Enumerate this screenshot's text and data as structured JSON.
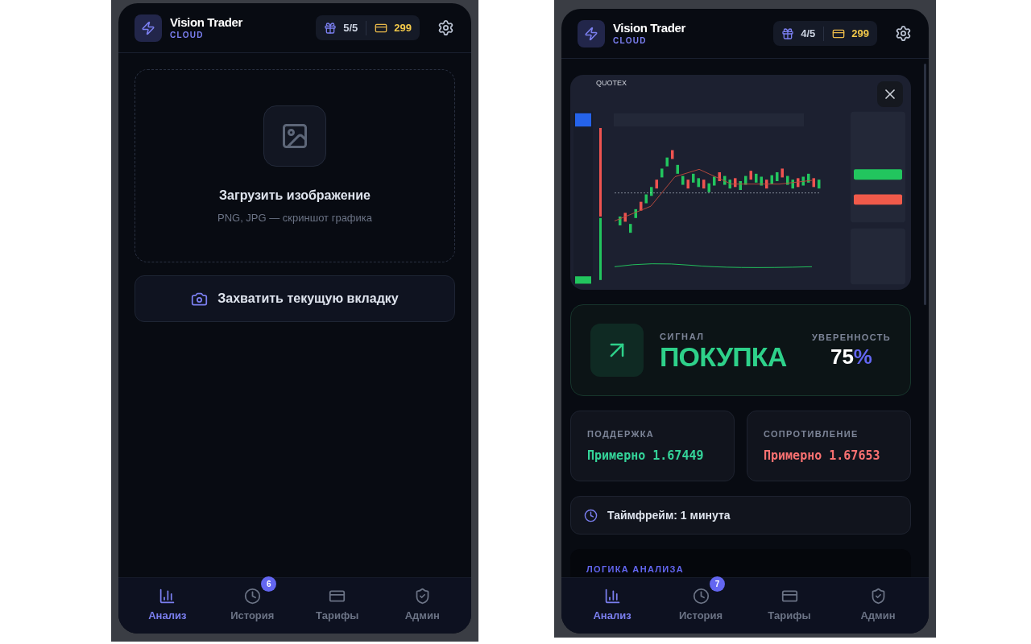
{
  "panels": [
    {
      "header": {
        "title": "Vision Trader",
        "subtitle": "CLOUD",
        "gifts": "5/5",
        "credits": "299"
      },
      "content": {
        "kind": "upload",
        "title": "Загрузить изображение",
        "hint": "PNG, JPG — скриншот графика",
        "capture_button": "Захватить текущую вкладку"
      },
      "nav": [
        {
          "label": "Анализ",
          "selected": true
        },
        {
          "label": "История",
          "selected": false,
          "badge": "6"
        },
        {
          "label": "Тарифы",
          "selected": false
        },
        {
          "label": "Админ",
          "selected": false
        }
      ]
    },
    {
      "header": {
        "title": "Vision Trader",
        "subtitle": "CLOUD",
        "gifts": "4/5",
        "credits": "299"
      },
      "content": {
        "kind": "result",
        "preview": {
          "brand": "QUOTEX"
        },
        "signal_label": "СИГНАЛ",
        "signal": "ПОКУПКА",
        "confidence_label": "УВЕРЕННОСТЬ",
        "confidence": "75",
        "confidence_unit": "%",
        "levels": [
          {
            "label": "ПОДДЕРЖКА",
            "value": "Примерно 1.67449",
            "kind": "support"
          },
          {
            "label": "СОПРОТИВЛЕНИЕ",
            "value": "Примерно 1.67653",
            "kind": "resistance"
          }
        ],
        "timeframe": "Таймфрейм: 1 минута",
        "logic_title": "ЛОГИКА АНАЛИЗА"
      },
      "nav": [
        {
          "label": "Анализ",
          "selected": true
        },
        {
          "label": "История",
          "selected": false,
          "badge": "7"
        },
        {
          "label": "Тарифы",
          "selected": false
        },
        {
          "label": "Админ",
          "selected": false
        }
      ]
    }
  ]
}
